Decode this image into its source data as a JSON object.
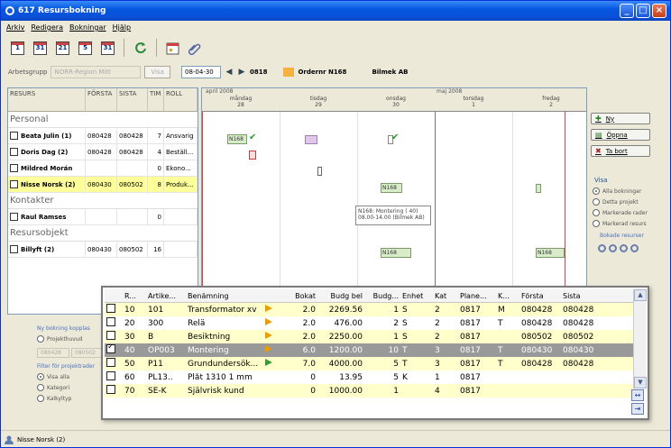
{
  "window": {
    "title": "617 Resursbokning"
  },
  "menu": [
    "Arkiv",
    "Redigera",
    "Bokningar",
    "Hjälp"
  ],
  "toolbar": {
    "buttons": [
      "1",
      "31",
      "21",
      "5",
      "31"
    ]
  },
  "filter": {
    "arbetsgrupp_label": "Arbetsgrupp",
    "arbetsgrupp_value": "NORR-Region Mitt",
    "visa_label": "Visa",
    "date": "08-04-30",
    "week": "0818",
    "order_label": "Ordernr N168",
    "customer": "Bilmek AB"
  },
  "grid": {
    "headers": [
      "RESURS",
      "FÖRSTA",
      "SISTA",
      "TIM",
      "ROLL"
    ],
    "sections": [
      {
        "name": "Personal",
        "rows": [
          {
            "name": "Beata Julin (1)",
            "forsta": "080428",
            "sista": "080428",
            "tim": "7",
            "roll": "Ansvarig"
          },
          {
            "name": "Doris Dag (2)",
            "forsta": "080428",
            "sista": "080428",
            "tim": "4",
            "roll": "Beställ..."
          },
          {
            "name": "Mildred Morán",
            "forsta": "",
            "sista": "",
            "tim": "0",
            "roll": "Ekono..."
          },
          {
            "name": "Nisse Norsk (2)",
            "forsta": "080430",
            "sista": "080502",
            "tim": "8",
            "roll": "Produk..."
          }
        ]
      },
      {
        "name": "Kontakter",
        "rows": [
          {
            "name": "Raul Ramses",
            "forsta": "",
            "sista": "",
            "tim": "0",
            "roll": ""
          }
        ]
      },
      {
        "name": "Resursobjekt",
        "rows": [
          {
            "name": "Billyft (2)",
            "forsta": "080430",
            "sista": "080502",
            "tim": "16",
            "roll": ""
          }
        ]
      }
    ]
  },
  "gantt": {
    "month1": "april 2008",
    "month2": "maj 2008",
    "days": [
      {
        "name": "måndag",
        "num": "28"
      },
      {
        "name": "tisdag",
        "num": "29"
      },
      {
        "name": "onsdag",
        "num": "30"
      },
      {
        "name": "torsdag",
        "num": "1"
      },
      {
        "name": "fredag",
        "num": "2"
      }
    ],
    "bar_label": "N168",
    "tooltip1": "N168: Montering ( 40)",
    "tooltip2": "08.00-14.00 (Bilmek AB)"
  },
  "right": {
    "ny": "Ny",
    "oppna": "Öppna",
    "tabort": "Ta bort",
    "visa": "Visa",
    "options": [
      "Alla bokningar",
      "Detta projekt",
      "Markerade rader",
      "Markerad resurs"
    ],
    "bokade": "Bokade resurser"
  },
  "left_low": {
    "ny_bokning": "Ny bokning kopplas",
    "projekthuvud": "Projekthuvud",
    "d1": "080428",
    "d2": "080502",
    "filter": "Filter för projektrader",
    "visa_alla": "Visa alla",
    "kategori": "Kategori",
    "kalkyltyp": "Kalkyltyp"
  },
  "popup": {
    "headers": [
      "R...",
      "Artike...",
      "Benämning",
      "",
      "Bokat",
      "Budg bel",
      "Budg...",
      "Enhet",
      "Kat",
      "Plane...",
      "K...",
      "Första",
      "Sista"
    ],
    "rows": [
      {
        "r": "10",
        "art": "101",
        "ben": "Transformator xv",
        "flag": "o",
        "bokat": "2.0",
        "budgbel": "2269.56",
        "budg": "1",
        "enhet": "S",
        "kat": "2",
        "plane": "0817",
        "k": "M",
        "forsta": "080428",
        "sista": "080428",
        "ck": false
      },
      {
        "r": "20",
        "art": "300",
        "ben": "Relä",
        "flag": "o",
        "bokat": "2.0",
        "budgbel": "476.00",
        "budg": "2",
        "enhet": "S",
        "kat": "2",
        "plane": "0817",
        "k": "T",
        "forsta": "080428",
        "sista": "080428",
        "ck": false
      },
      {
        "r": "30",
        "art": "B",
        "ben": "Besiktning",
        "flag": "o",
        "bokat": "2.0",
        "budgbel": "2250.00",
        "budg": "1",
        "enhet": "S",
        "kat": "2",
        "plane": "0817",
        "k": "",
        "forsta": "080502",
        "sista": "080502",
        "ck": false
      },
      {
        "r": "40",
        "art": "OP003",
        "ben": "Montering",
        "flag": "o",
        "bokat": "6.0",
        "budgbel": "1200.00",
        "budg": "10",
        "enhet": "T",
        "kat": "3",
        "plane": "0817",
        "k": "T",
        "forsta": "080430",
        "sista": "080430",
        "ck": true
      },
      {
        "r": "50",
        "art": "P11",
        "ben": "Grundundersök...",
        "flag": "g",
        "bokat": "7.0",
        "budgbel": "4000.00",
        "budg": "5",
        "enhet": "T",
        "kat": "3",
        "plane": "0817",
        "k": "T",
        "forsta": "080428",
        "sista": "080428",
        "ck": false
      },
      {
        "r": "60",
        "art": "PL13..",
        "ben": "Plåt 1310 1 mm",
        "flag": "",
        "bokat": "0",
        "budgbel": "13.95",
        "budg": "5",
        "enhet": "K",
        "kat": "1",
        "plane": "0817",
        "k": "",
        "forsta": "",
        "sista": "",
        "ck": false
      },
      {
        "r": "70",
        "art": "SE-K",
        "ben": "Självrisk kund",
        "flag": "",
        "bokat": "0",
        "budgbel": "1000.00",
        "budg": "1",
        "enhet": "",
        "kat": "4",
        "plane": "0817",
        "k": "",
        "forsta": "",
        "sista": "",
        "ck": false
      }
    ]
  },
  "status": "Nisse Norsk (2)"
}
